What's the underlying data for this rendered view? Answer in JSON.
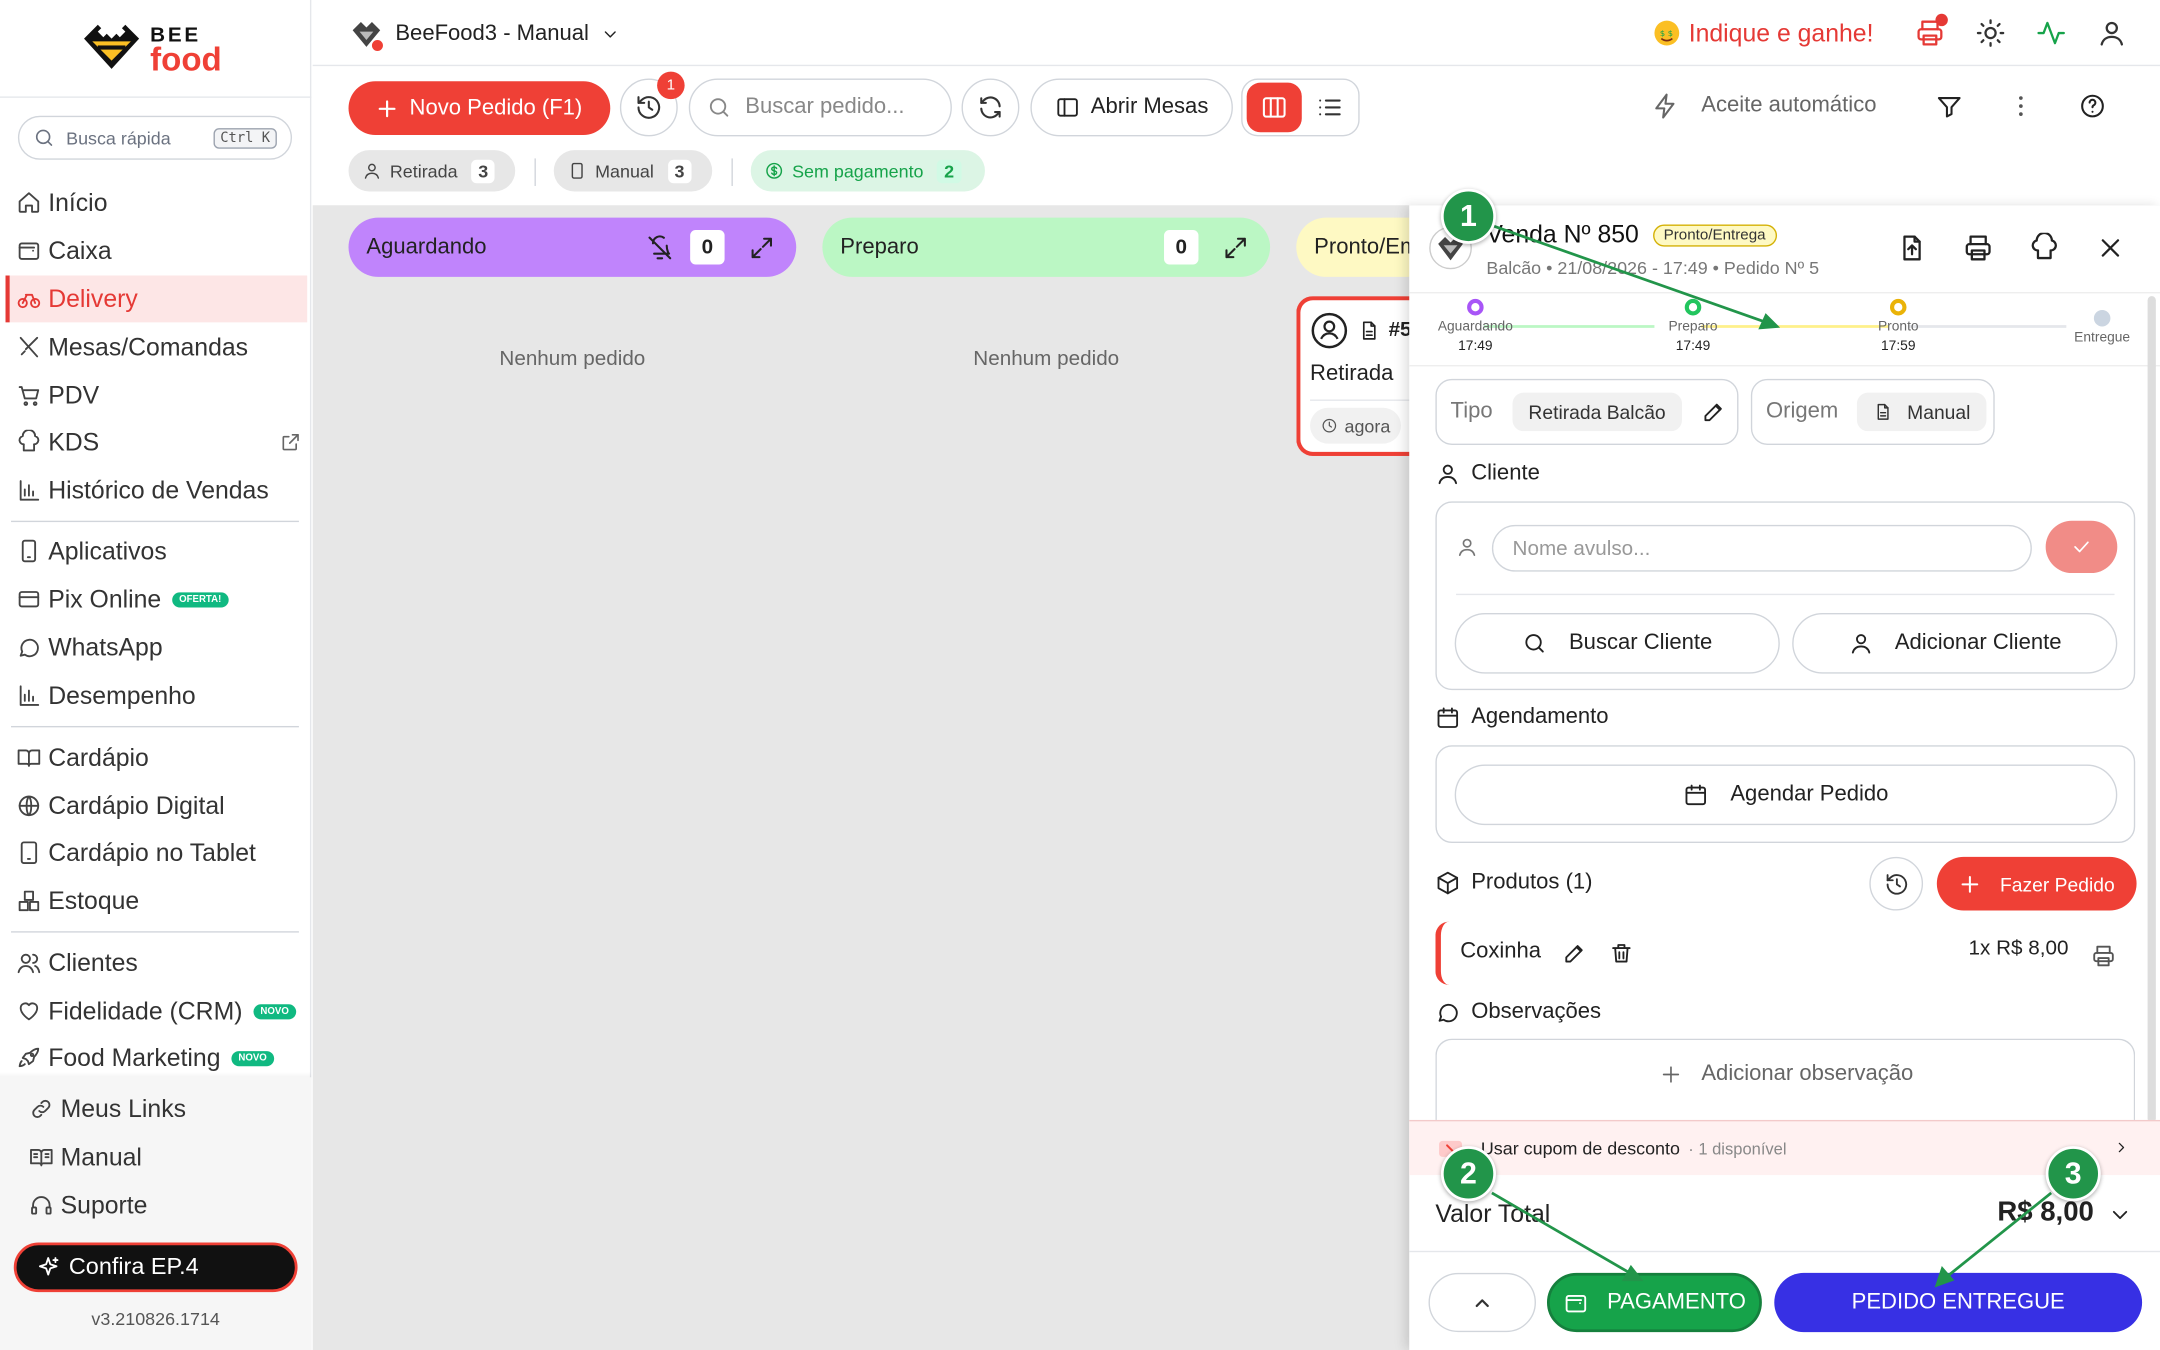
{
  "sidebar": {
    "logo_top": "BEE",
    "logo_bottom": "food",
    "quick_search": "Busca rápida",
    "shortcut": "Ctrl K",
    "items": [
      {
        "label": "Início",
        "icon": "home-icon"
      },
      {
        "label": "Caixa",
        "icon": "wallet-icon"
      },
      {
        "label": "Delivery",
        "icon": "bike-icon",
        "active": true
      },
      {
        "label": "Mesas/Comandas",
        "icon": "utensils-icon"
      },
      {
        "label": "PDV",
        "icon": "cart-icon"
      },
      {
        "label": "KDS",
        "icon": "chef-hat-icon"
      },
      {
        "label": "Histórico de Vendas",
        "icon": "bar-chart-icon"
      },
      {
        "label": "Aplicativos",
        "icon": "phone-icon"
      },
      {
        "label": "Pix Online",
        "icon": "card-icon",
        "badge": "OFERTA!"
      },
      {
        "label": "WhatsApp",
        "icon": "chat-icon"
      },
      {
        "label": "Desempenho",
        "icon": "bar-chart-icon"
      },
      {
        "label": "Cardápio",
        "icon": "book-icon"
      },
      {
        "label": "Cardápio Digital",
        "icon": "globe-icon"
      },
      {
        "label": "Cardápio no Tablet",
        "icon": "tablet-icon"
      },
      {
        "label": "Estoque",
        "icon": "boxes-icon"
      },
      {
        "label": "Clientes",
        "icon": "users-icon"
      },
      {
        "label": "Fidelidade (CRM)",
        "icon": "heart-icon",
        "badge": "NOVO"
      },
      {
        "label": "Food Marketing",
        "icon": "rocket-icon",
        "badge": "NOVO"
      }
    ],
    "bottom_items": [
      {
        "label": "Meus Links",
        "icon": "link-icon"
      },
      {
        "label": "Manual",
        "icon": "book-open-icon"
      },
      {
        "label": "Suporte",
        "icon": "headset-icon"
      }
    ],
    "promo": "Confira EP.4",
    "version": "v3.210826.1714"
  },
  "header": {
    "store": "BeeFood3 - Manual",
    "referral": "Indique e ganhe!"
  },
  "toolbar": {
    "new_order": "Novo Pedido (F1)",
    "history_badge": "1",
    "search_placeholder": "Buscar pedido...",
    "open_tables": "Abrir Mesas",
    "auto_accept": "Aceite automático",
    "filters": [
      {
        "label": "Retirada",
        "count": "3"
      },
      {
        "label": "Manual",
        "count": "3"
      },
      {
        "label": "Sem pagamento",
        "count": "2"
      }
    ]
  },
  "board": {
    "columns": [
      {
        "title": "Aguardando",
        "count": "0",
        "color": "#c084fc",
        "empty": "Nenhum pedido"
      },
      {
        "title": "Preparo",
        "count": "0",
        "color": "#bbf7c4",
        "empty": "Nenhum pedido"
      },
      {
        "title": "Pronto/Em",
        "color": "#fef9c3"
      }
    ],
    "card": {
      "number": "#5",
      "type": "Retirada",
      "time": "agora"
    }
  },
  "panel": {
    "title": "Venda Nº 850",
    "status": "Pronto/Entrega",
    "subtitle": "Balcão • 21/08/2026 - 17:49 • Pedido Nº 5",
    "steps": [
      {
        "label": "Aguardando",
        "time": "17:49",
        "color": "#a855f7"
      },
      {
        "label": "Preparo",
        "time": "17:49",
        "color": "#22c55e"
      },
      {
        "label": "Pronto",
        "time": "17:59",
        "color": "#eab308"
      },
      {
        "label": "Entregue",
        "time": "",
        "color": "#cbd5e1"
      }
    ],
    "tipo_label": "Tipo",
    "tipo_value": "Retirada Balcão",
    "origem_label": "Origem",
    "origem_value": "Manual",
    "cliente_label": "Cliente",
    "nome_placeholder": "Nome avulso...",
    "buscar_cliente": "Buscar Cliente",
    "adicionar_cliente": "Adicionar Cliente",
    "agendamento_label": "Agendamento",
    "agendar": "Agendar Pedido",
    "produtos_label": "Produtos (1)",
    "fazer_pedido": "Fazer Pedido",
    "product_name": "Coxinha",
    "product_price": "1x R$ 8,00",
    "observacoes_label": "Observações",
    "add_obs": "Adicionar observação",
    "coupon": "Usar cupom de desconto",
    "coupon_note": "· 1 disponível",
    "valor_label": "Valor Total",
    "valor": "R$ 8,00",
    "pagamento": "PAGAMENTO",
    "entregue": "PEDIDO ENTREGUE"
  },
  "annotations": [
    "1",
    "2",
    "3"
  ]
}
